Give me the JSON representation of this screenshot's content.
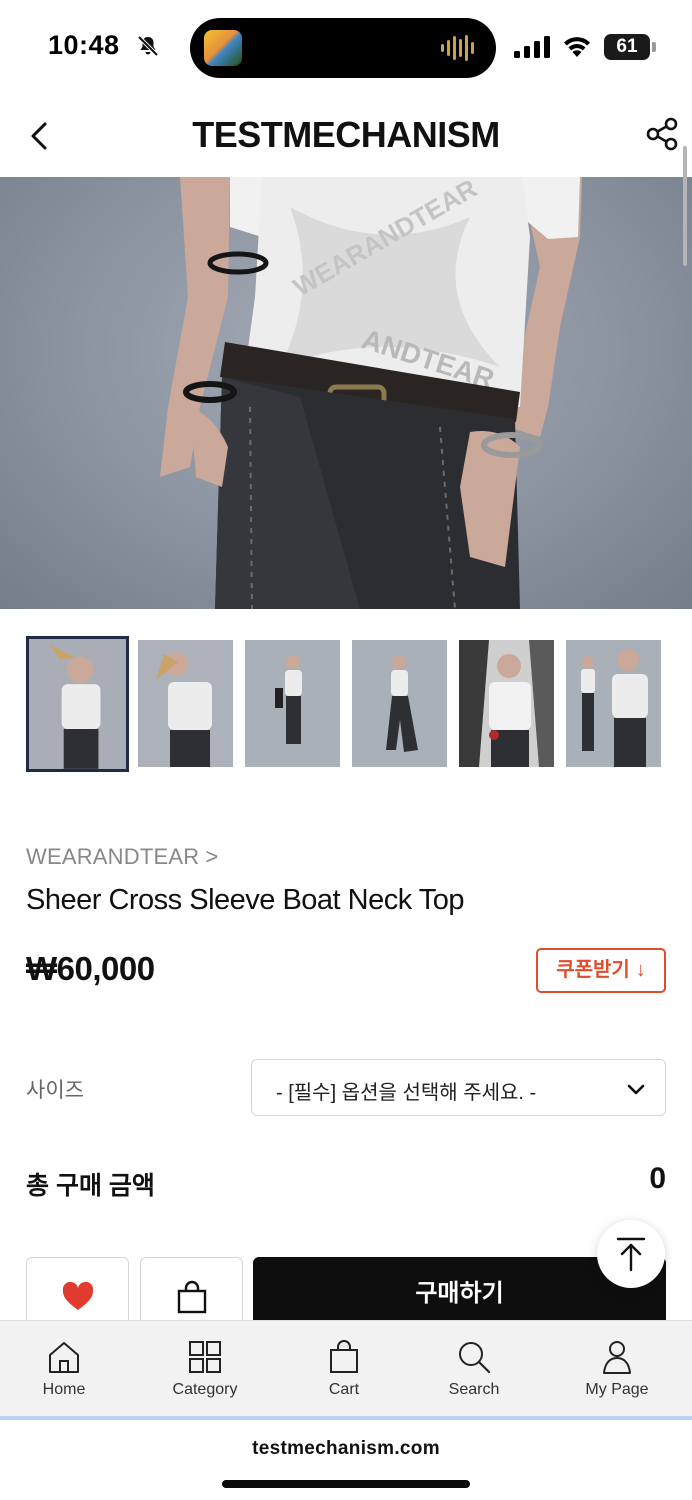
{
  "status_bar": {
    "time": "10:48",
    "battery": "61"
  },
  "header": {
    "title": "TESTMECHANISM"
  },
  "product": {
    "brand": "WEARANDTEAR",
    "brand_chevron": ">",
    "name": "Sheer Cross Sleeve Boat Neck Top",
    "price": "₩60,000",
    "coupon_button": "쿠폰받기",
    "coupon_arrow": "↓",
    "thumbnail_count": 6
  },
  "option": {
    "label": "사이즈",
    "select_value": "- [필수] 옵션을 선택해 주세요. -"
  },
  "total": {
    "label": "총 구매 금액",
    "value": "0"
  },
  "actions": {
    "buy_button": "구매하기",
    "wishlist_color": "#e03b2e"
  },
  "tabbar": {
    "items": [
      {
        "label": "Home",
        "icon": "home-icon"
      },
      {
        "label": "Category",
        "icon": "grid-icon"
      },
      {
        "label": "Cart",
        "icon": "bag-icon"
      },
      {
        "label": "Search",
        "icon": "search-icon"
      },
      {
        "label": "My Page",
        "icon": "user-icon"
      }
    ]
  },
  "browser": {
    "url": "testmechanism.com"
  },
  "colors": {
    "coupon_accent": "#e14c2a",
    "buy_button_bg": "#0e0e0e",
    "active_thumb_border": "#1f2a44"
  }
}
